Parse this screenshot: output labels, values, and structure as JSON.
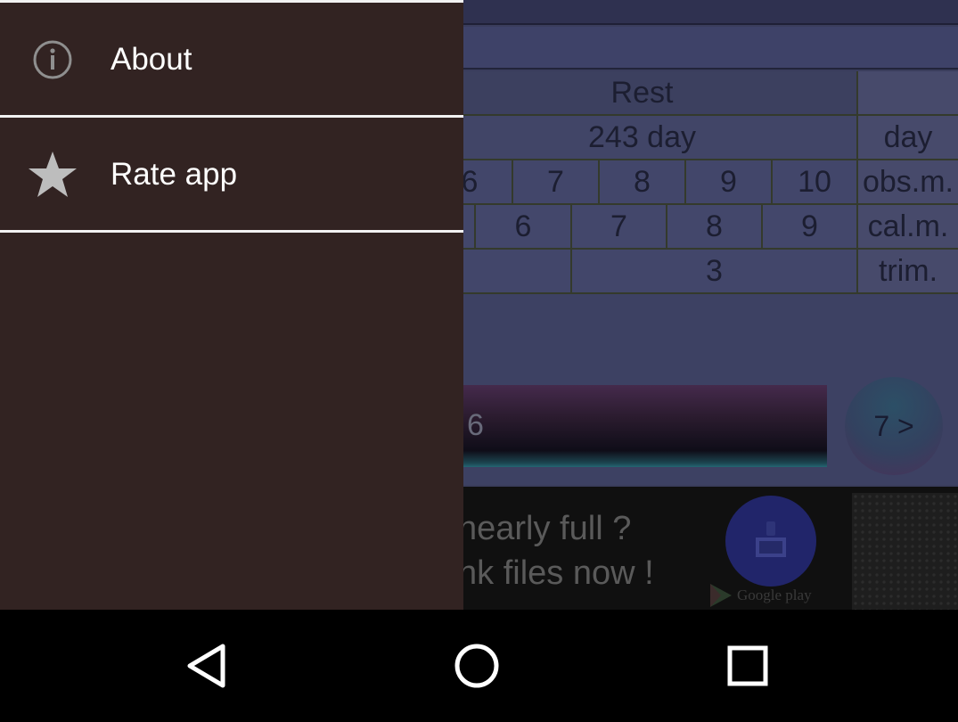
{
  "background_app": {
    "grid": {
      "rest_label": "Rest",
      "days_label": "243 day",
      "day_unit": "day",
      "obs_cells": [
        "6",
        "7",
        "8",
        "9",
        "10"
      ],
      "obs_label": "obs.m.",
      "cal_cells": [
        "6",
        "7",
        "8",
        "9"
      ],
      "cal_label": "cal.m.",
      "trim_value": "3",
      "trim_label": "trim."
    },
    "progress_text": "6",
    "next_button": "7 >"
  },
  "ad": {
    "line1": "nearly full ?",
    "line2": "nk files now !",
    "store_label": "Google play",
    "icon": "broom-icon"
  },
  "drawer": {
    "items": [
      {
        "label": "About",
        "icon": "info-icon"
      },
      {
        "label": "Rate app",
        "icon": "star-icon"
      }
    ]
  },
  "navbar": {
    "back": "back-triangle-icon",
    "home": "home-circle-icon",
    "recents": "recents-square-icon"
  },
  "colors": {
    "drawer_bg": "#322322",
    "divider": "#f2f2f2",
    "nav_bg": "#000000",
    "app_bg": "#3a3d5c"
  }
}
